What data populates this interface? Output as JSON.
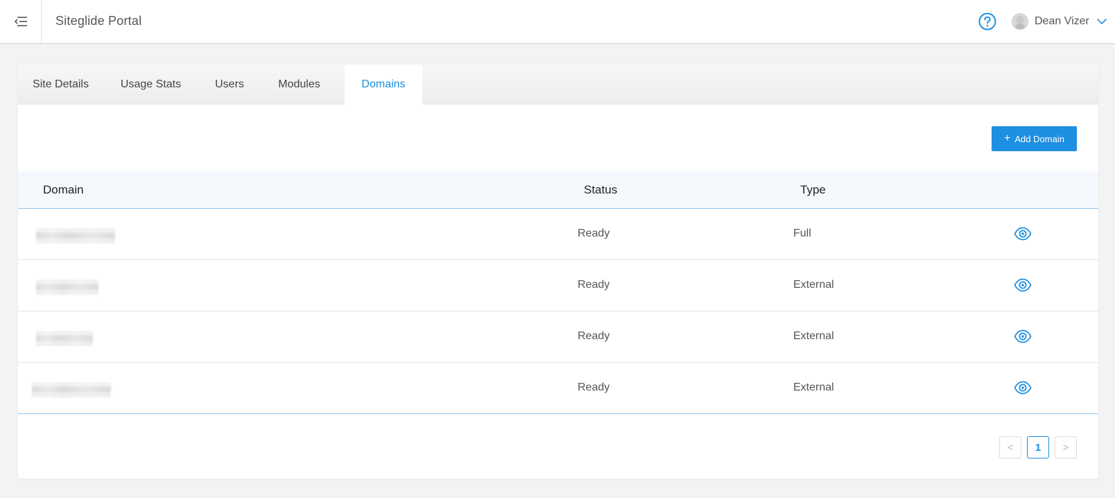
{
  "app": {
    "title": "Siteglide Portal"
  },
  "header": {
    "menu_icon": "menu-collapse-icon",
    "help_icon": "help-circle-icon",
    "user_name": "Dean Vizer",
    "user_menu_icon": "chevron-down-icon"
  },
  "tabs": [
    {
      "label": "Site Details",
      "active": false
    },
    {
      "label": "Usage Stats",
      "active": false
    },
    {
      "label": "Users",
      "active": false
    },
    {
      "label": "Modules",
      "active": false
    },
    {
      "label": "Domains",
      "active": true
    }
  ],
  "toolbar": {
    "add_label": "Add Domain",
    "add_icon": "plus-icon"
  },
  "table": {
    "columns": [
      "Domain",
      "Status",
      "Type"
    ],
    "rows": [
      {
        "domain": "",
        "status": "Ready",
        "type": "Full",
        "action_icon": "eye-icon"
      },
      {
        "domain": "",
        "status": "Ready",
        "type": "External",
        "action_icon": "eye-icon"
      },
      {
        "domain": "",
        "status": "Ready",
        "type": "External",
        "action_icon": "eye-icon"
      },
      {
        "domain": "",
        "status": "Ready",
        "type": "External",
        "action_icon": "eye-icon"
      }
    ]
  },
  "pagination": {
    "prev": "<",
    "current_page": "1",
    "next": ">"
  },
  "colors": {
    "accent": "#1e8fe1",
    "header_border": "#8cc6ee",
    "background": "#f3f3f3"
  }
}
